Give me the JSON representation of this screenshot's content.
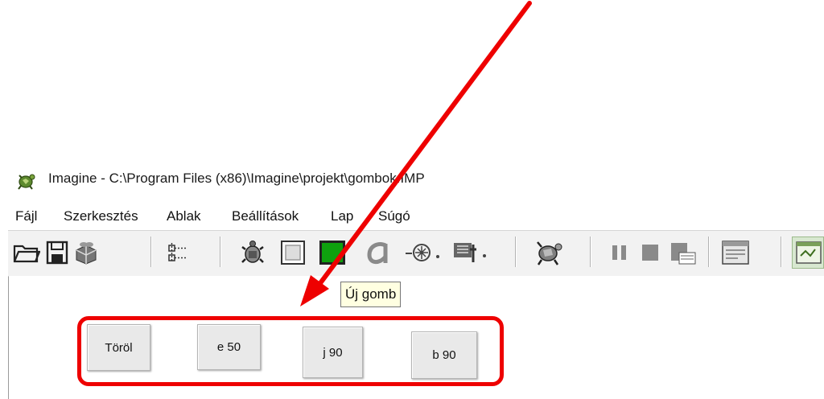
{
  "window": {
    "title": "Imagine - C:\\Program Files (x86)\\Imagine\\projekt\\gombok.IMP"
  },
  "menu": [
    "Fájl",
    "Szerkesztés",
    "Ablak",
    "Beállítások",
    "Lap",
    "Súgó"
  ],
  "toolbar": {
    "icons": [
      "open-folder-icon",
      "save-icon",
      "gift-icon",
      "tree-icon",
      "turtle-icon",
      "pane-icon",
      "new-button-icon",
      "text-icon",
      "slider-icon",
      "shape-icon",
      "hatch-turtle-icon",
      "pause-icon",
      "stop-icon",
      "run-icon",
      "window-icon",
      "page-icon"
    ],
    "tooltip": "Új gomb"
  },
  "canvas_buttons": [
    {
      "label": "Töröl"
    },
    {
      "label": "e 50"
    },
    {
      "label": "j 90"
    },
    {
      "label": "b 90"
    }
  ],
  "annotation": {
    "arrow_color": "#ee0000",
    "highlight_color": "#ee0000"
  }
}
